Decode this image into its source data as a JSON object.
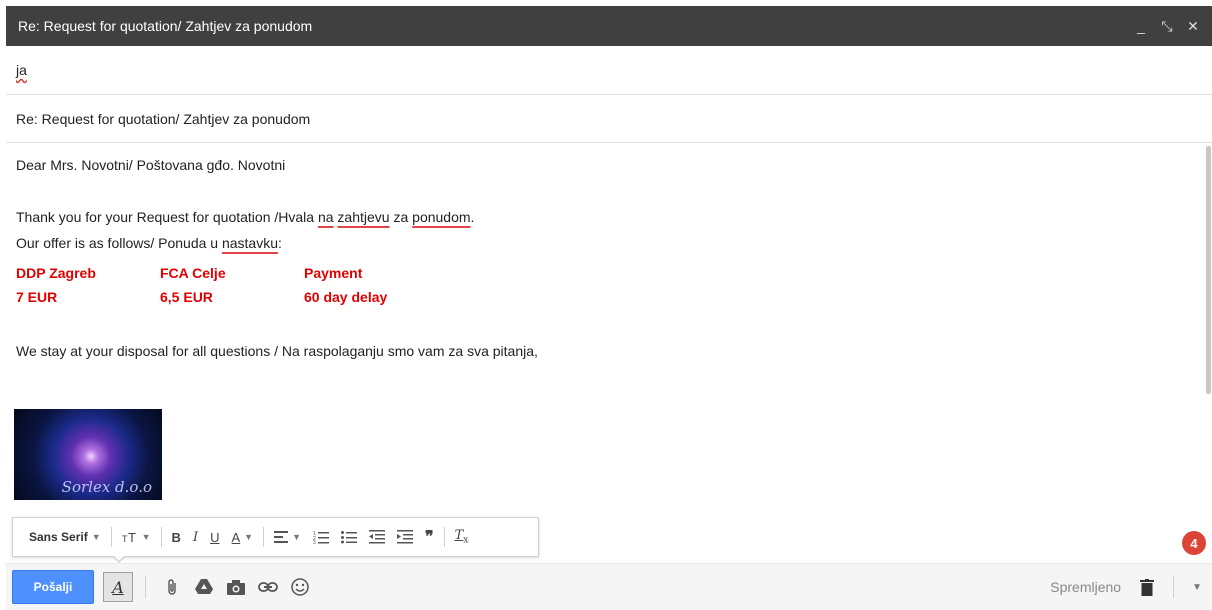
{
  "window": {
    "title": "Re: Request for quotation/ Zahtjev za ponudom",
    "controls": {
      "minimize": "_",
      "popout": "⤡",
      "close": "✕"
    }
  },
  "compose": {
    "recipient": "ja",
    "subject": "Re: Request for quotation/ Zahtjev za ponudom",
    "body": {
      "greeting": "Dear Mrs. Novotni/ Poštovana gđo. Novotni",
      "thanks_prefix": "Thank you for your Request for quotation /Hvala ",
      "thanks_w1": "na",
      "thanks_w2": "zahtjevu",
      "thanks_mid": " za ",
      "thanks_w3": "ponudom",
      "thanks_end": ".",
      "offer_prefix": "Our offer is as follows/ Ponuda u ",
      "offer_word": "nastavku",
      "offer_end": ":",
      "offer_table": {
        "headers": [
          "DDP Zagreb",
          "FCA Celje",
          "Payment"
        ],
        "values": [
          "7 EUR",
          "6,5 EUR",
          "60 day delay"
        ]
      },
      "closing": "We stay at your disposal for all questions / Na raspolaganju smo vam za sva pitanja,",
      "signature_logo_text": "Sorlex d.o.o"
    }
  },
  "format_toolbar": {
    "font": "Sans Serif",
    "size_icon": "text-size-icon",
    "bold": "B",
    "italic": "I",
    "underline": "U",
    "text_color": "A"
  },
  "notification_badge": "4",
  "bottom_bar": {
    "send_label": "Pošalji",
    "format_toggle": "A",
    "saved_label": "Spremljeno"
  },
  "colors": {
    "titlebar": "#404040",
    "send_button": "#4d90fe",
    "offer_text": "#e00000",
    "badge": "#db4437"
  }
}
